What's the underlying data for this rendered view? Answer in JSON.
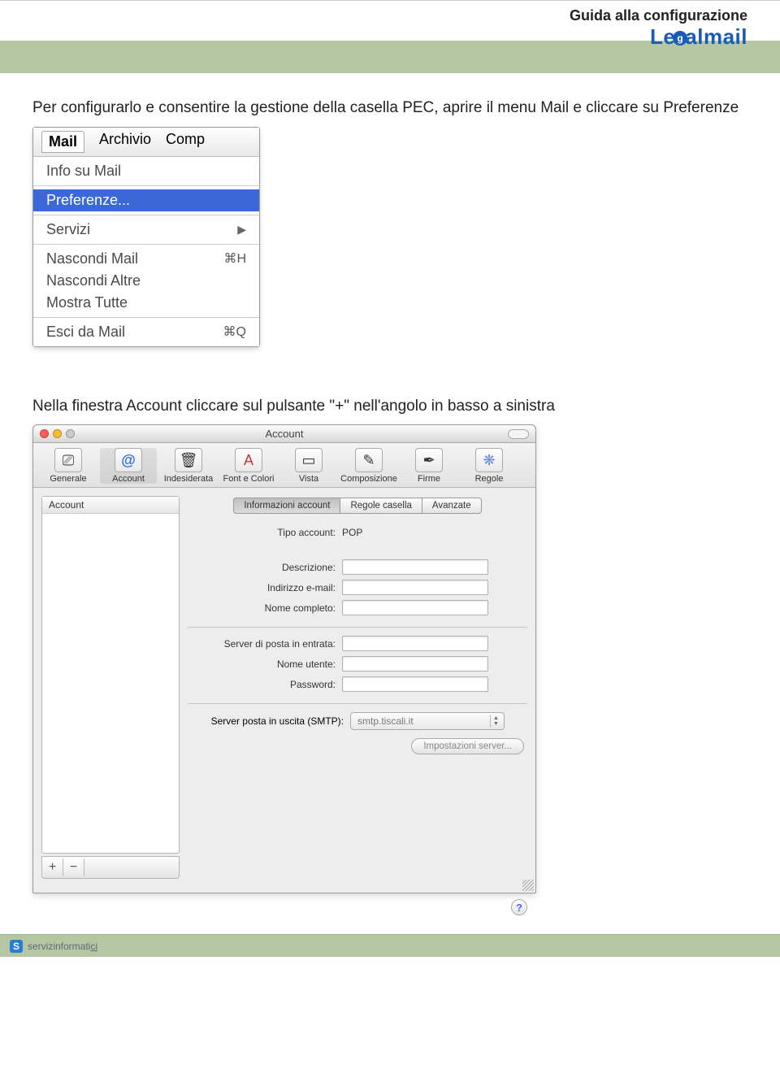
{
  "header": {
    "guide_title": "Guida alla configurazione",
    "logo_text_pre": "Le",
    "logo_ball": "g",
    "logo_text_post": "almail"
  },
  "intro_paragraph": "Per configurarlo e consentire la gestione della casella PEC, aprire il menu Mail e cliccare su Preferenze",
  "mac_menu": {
    "bar": {
      "active": "Mail",
      "items": [
        "Archivio",
        "Comp"
      ]
    },
    "items": [
      {
        "label": "Info su Mail",
        "shortcut": ""
      },
      {
        "sep": true
      },
      {
        "label": "Preferenze...",
        "selected": true
      },
      {
        "sep": true
      },
      {
        "label": "Servizi",
        "submenu": true
      },
      {
        "sep": true
      },
      {
        "label": "Nascondi Mail",
        "shortcut": "⌘H"
      },
      {
        "label": "Nascondi Altre",
        "shortcut": ""
      },
      {
        "label": "Mostra Tutte",
        "shortcut": ""
      },
      {
        "sep": true
      },
      {
        "label": "Esci da Mail",
        "shortcut": "⌘Q"
      }
    ]
  },
  "second_paragraph": "Nella finestra Account cliccare sul pulsante \"+\" nell'angolo in basso a sinistra",
  "account_window": {
    "title": "Account",
    "toolbar": [
      {
        "label": "Generale",
        "glyph": "⌕"
      },
      {
        "label": "Account",
        "glyph": "@",
        "selected": true
      },
      {
        "label": "Indesiderata",
        "glyph": "✉"
      },
      {
        "label": "Font e Colori",
        "glyph": "A"
      },
      {
        "label": "Vista",
        "glyph": "▭"
      },
      {
        "label": "Composizione",
        "glyph": "✎"
      },
      {
        "label": "Firme",
        "glyph": "✒"
      },
      {
        "label": "Regole",
        "glyph": "❋"
      }
    ],
    "list_header": "Account",
    "tabs": [
      {
        "label": "Informazioni account",
        "active": true
      },
      {
        "label": "Regole casella"
      },
      {
        "label": "Avanzate"
      }
    ],
    "fields": {
      "tipo_label": "Tipo account:",
      "tipo_value": "POP",
      "descrizione_label": "Descrizione:",
      "email_label": "Indirizzo e-mail:",
      "nome_label": "Nome completo:",
      "server_in_label": "Server di posta in entrata:",
      "utente_label": "Nome utente:",
      "password_label": "Password:",
      "smtp_label": "Server posta in uscita (SMTP):",
      "smtp_value": "smtp.tiscali.it",
      "server_settings_btn": "Impostazioni server..."
    },
    "footer": {
      "plus": "+",
      "minus": "−",
      "help": "?"
    }
  },
  "footer": {
    "badge": "S",
    "text_pre": "servizinformati",
    "text_u": "ci"
  }
}
